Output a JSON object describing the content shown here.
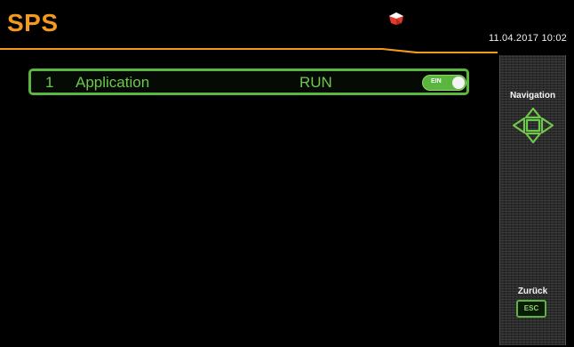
{
  "header": {
    "title": "SPS",
    "datetime": "11.04.2017  10:02",
    "status_icon": "alert-shield-icon"
  },
  "applications": [
    {
      "index": "1",
      "name": "Application",
      "state": "RUN",
      "toggle_label": "EIN",
      "toggle_on": true
    }
  ],
  "sidebar": {
    "navigation_label": "Navigation",
    "navigation_icon": "direction-pad-icon",
    "back_label": "Zurück",
    "esc_label": "ESC"
  },
  "colors": {
    "accent_orange": "#f39a1e",
    "accent_green": "#5ab63e",
    "background": "#000000",
    "text_white": "#f0f0f0"
  }
}
